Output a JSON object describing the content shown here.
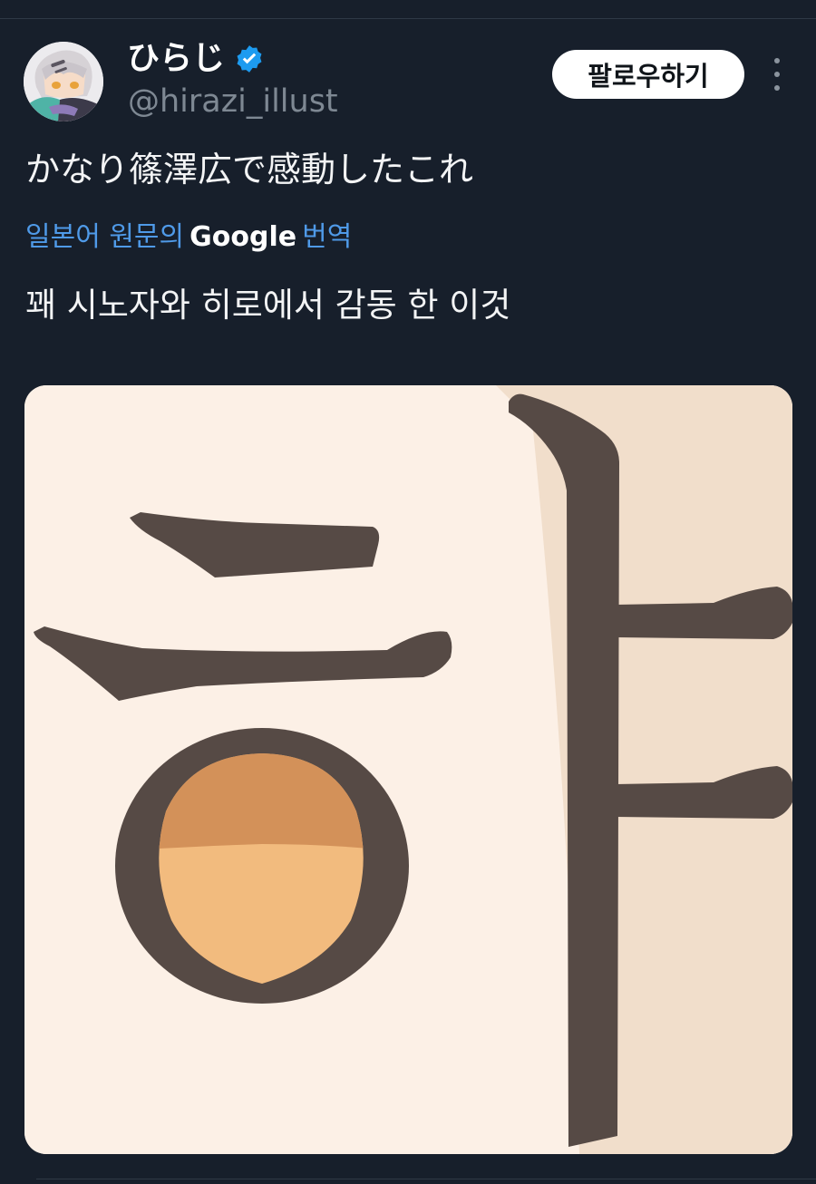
{
  "author": {
    "display_name": "ひらじ",
    "handle": "@hirazi_illust",
    "verified": true,
    "avatar_icon": "anime-girl-avatar"
  },
  "actions": {
    "follow_label": "팔로우하기",
    "more_icon": "vertical-ellipsis-icon"
  },
  "tweet": {
    "text": "かなり篠澤広で感動したこれ"
  },
  "translation": {
    "prefix": "일본어 원문의",
    "provider": "Google",
    "suffix": "번역",
    "text": "꽤 시노자와 히로에서 감동 한 이것"
  },
  "media": {
    "description_icon": "hangul-character-illustration"
  },
  "colors": {
    "background": "#171f2b",
    "link": "#4f9ae8",
    "verified": "#1d9bf0",
    "stroke": "#564a45",
    "paper": "#fcf0e6"
  }
}
